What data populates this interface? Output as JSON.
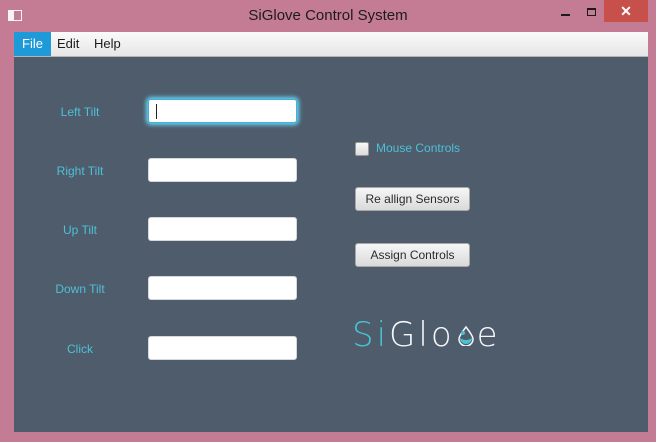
{
  "window": {
    "title": "SiGlove Control System"
  },
  "menu": {
    "file": "File",
    "edit": "Edit",
    "help": "Help"
  },
  "form": {
    "fields": [
      {
        "label": "Left Tilt",
        "value": ""
      },
      {
        "label": "Right Tilt",
        "value": ""
      },
      {
        "label": "Up Tilt",
        "value": ""
      },
      {
        "label": "Down Tilt",
        "value": ""
      },
      {
        "label": "Click",
        "value": ""
      }
    ]
  },
  "controls": {
    "mouse_controls_label": "Mouse Controls",
    "mouse_controls_checked": false,
    "realign_label": "Re allign Sensors",
    "assign_label": "Assign Controls"
  },
  "logo": {
    "part1": "Si",
    "part2": "Glo",
    "part3": "e"
  },
  "colors": {
    "accent": "#4ec0d6",
    "panel": "#4e5c6c",
    "frame": "#c47c95",
    "close": "#c7504b"
  }
}
